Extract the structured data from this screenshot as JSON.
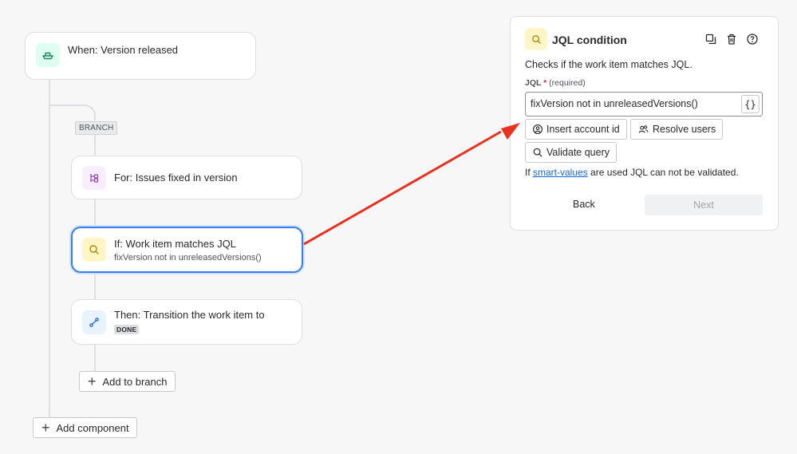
{
  "rule": {
    "trigger": {
      "title": "When: Version released",
      "icon": "ship-icon",
      "color": "#1f845a"
    },
    "branch_tag": "BRANCH",
    "branch_step": {
      "title": "For: Issues fixed in version",
      "icon": "branch-icon",
      "color": "#964ac0"
    },
    "condition_step": {
      "title": "If: Work item matches JQL",
      "subtitle": "fixVersion not in unreleasedVersions()",
      "icon": "search-icon",
      "color": "#b38600"
    },
    "action_step": {
      "title": "Then: Transition the work item to",
      "status": "DONE",
      "icon": "transition-icon",
      "color": "#1868db"
    },
    "add_to_branch_label": "Add to branch",
    "add_component_label": "Add component"
  },
  "panel": {
    "title": "JQL condition",
    "description": "Checks if the work item matches JQL.",
    "field_label": "JQL",
    "required_marker": "*",
    "required_text": "(required)",
    "jql_value": "fixVersion not in unreleasedVersions()",
    "insert_account_label": "Insert account id",
    "resolve_users_label": "Resolve users",
    "validate_label": "Validate query",
    "note_prefix": "If",
    "note_link": "smart-values",
    "note_suffix": "are used JQL can not be validated.",
    "back_label": "Back",
    "next_label": "Next"
  },
  "annotation": {
    "arrow_color": "#e8321f"
  }
}
